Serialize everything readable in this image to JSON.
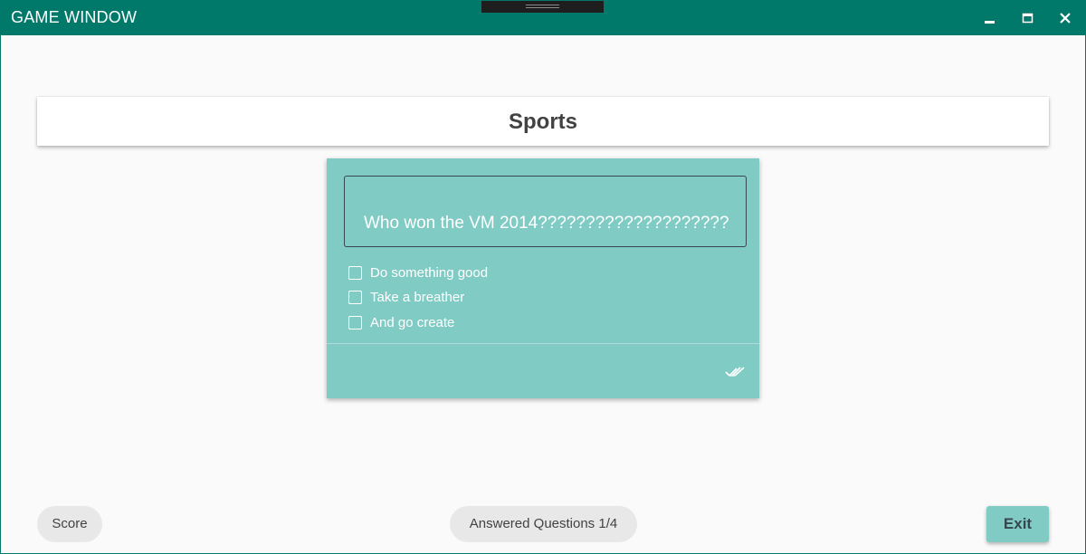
{
  "window": {
    "title": "GAME WINDOW",
    "controls": [
      "minimize-icon",
      "maximize-icon",
      "close-icon"
    ]
  },
  "colors": {
    "titlebar": "#00796b",
    "card_accent": "#80cbc4",
    "background": "#fafafa",
    "chip": "#e8e8e8"
  },
  "topic": {
    "title": "Sports"
  },
  "question": {
    "text": "Who won the VM 2014????????????????????",
    "options": [
      {
        "label": "Do something good",
        "checked": false
      },
      {
        "label": "Take a breather",
        "checked": false
      },
      {
        "label": "And go create",
        "checked": false
      }
    ],
    "submit_icon": "double-check-icon"
  },
  "footer": {
    "score_label": "Score",
    "answered_label": "Answered Questions 1/4",
    "exit_label": "Exit"
  }
}
